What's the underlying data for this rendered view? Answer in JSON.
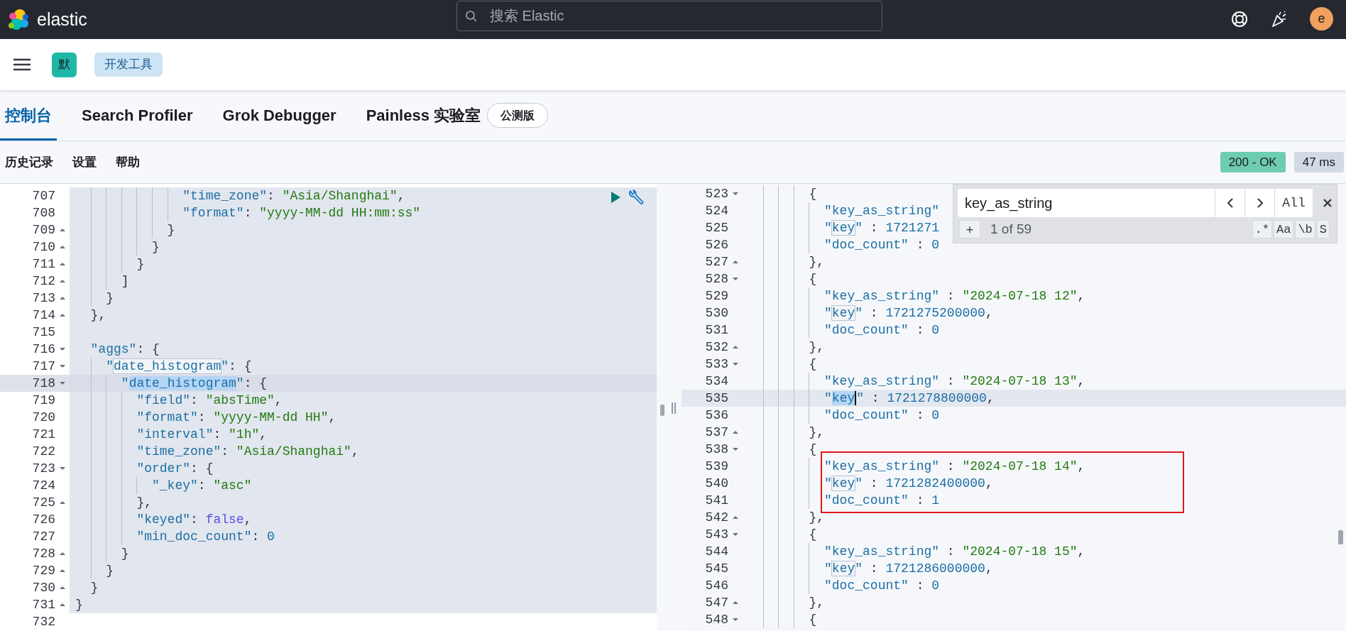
{
  "header": {
    "logo_text": "elastic",
    "search": {
      "placeholder": "搜索 Elastic"
    },
    "avatar": "e"
  },
  "nav": {
    "space_badge": "默",
    "breadcrumbs": [
      {
        "label": "开发工具"
      }
    ]
  },
  "tabs": [
    {
      "label": "控制台",
      "selected": true
    },
    {
      "label": "Search Profiler",
      "selected": false
    },
    {
      "label": "Grok Debugger",
      "selected": false
    },
    {
      "label": "Painless 实验室",
      "selected": false,
      "badge": "公测版"
    }
  ],
  "toolbar": {
    "links": [
      "历史记录",
      "设置",
      "帮助"
    ],
    "status": "200 - OK",
    "time": "47 ms"
  },
  "request_editor": {
    "lines": [
      {
        "number": "707",
        "highlighted": true,
        "selected": false,
        "fold_start": false,
        "fold_end": false,
        "tokens": [
          {
            "kind": "key",
            "text": "              \"time_zone\""
          },
          {
            "kind": "punct",
            "text": ": "
          },
          {
            "kind": "string",
            "text": "\"Asia/Shanghai\""
          },
          {
            "kind": "punct",
            "text": ","
          }
        ]
      },
      {
        "number": "708",
        "highlighted": true,
        "selected": false,
        "fold_start": false,
        "fold_end": false,
        "tokens": [
          {
            "kind": "key",
            "text": "              \"format\""
          },
          {
            "kind": "punct",
            "text": ": "
          },
          {
            "kind": "string",
            "text": "\"yyyy-MM-dd HH:mm:ss\""
          }
        ]
      },
      {
        "number": "709",
        "highlighted": true,
        "selected": false,
        "fold_start": false,
        "fold_end": true,
        "tokens": [
          {
            "kind": "punct",
            "text": "            }"
          }
        ]
      },
      {
        "number": "710",
        "highlighted": true,
        "selected": false,
        "fold_start": false,
        "fold_end": true,
        "tokens": [
          {
            "kind": "punct",
            "text": "          }"
          }
        ]
      },
      {
        "number": "711",
        "highlighted": true,
        "selected": false,
        "fold_start": false,
        "fold_end": true,
        "tokens": [
          {
            "kind": "punct",
            "text": "        }"
          }
        ]
      },
      {
        "number": "712",
        "highlighted": true,
        "selected": false,
        "fold_start": false,
        "fold_end": true,
        "tokens": [
          {
            "kind": "punct",
            "text": "      ]"
          }
        ]
      },
      {
        "number": "713",
        "highlighted": true,
        "selected": false,
        "fold_start": false,
        "fold_end": true,
        "tokens": [
          {
            "kind": "punct",
            "text": "    }"
          }
        ]
      },
      {
        "number": "714",
        "highlighted": true,
        "selected": false,
        "fold_start": false,
        "fold_end": true,
        "tokens": [
          {
            "kind": "punct",
            "text": "  },"
          }
        ]
      },
      {
        "number": "715",
        "highlighted": true,
        "selected": false,
        "fold_start": false,
        "fold_end": false
      },
      {
        "number": "716",
        "highlighted": true,
        "selected": false,
        "fold_start": true,
        "fold_end": false,
        "tokens": [
          {
            "kind": "key",
            "text": "  \"aggs\""
          },
          {
            "kind": "punct",
            "text": ": {"
          }
        ]
      },
      {
        "number": "717",
        "highlighted": true,
        "selected": false,
        "fold_start": true,
        "fold_end": false,
        "tokens": [
          {
            "kind": "key",
            "text": "    \""
          },
          {
            "kind": "match",
            "text": "date_histogram"
          },
          {
            "kind": "key",
            "text": "\""
          },
          {
            "kind": "punct",
            "text": ": {"
          }
        ]
      },
      {
        "number": "718",
        "highlighted": true,
        "selected": true,
        "fold_start": true,
        "fold_end": false,
        "tokens": [
          {
            "kind": "key",
            "text": "      \""
          },
          {
            "kind": "selection",
            "text": "date_histogram"
          },
          {
            "kind": "key",
            "text": "\""
          },
          {
            "kind": "punct",
            "text": ": {"
          }
        ]
      },
      {
        "number": "719",
        "highlighted": true,
        "selected": false,
        "fold_start": false,
        "fold_end": false,
        "tokens": [
          {
            "kind": "key",
            "text": "        \"field\""
          },
          {
            "kind": "punct",
            "text": ": "
          },
          {
            "kind": "string",
            "text": "\"absTime\""
          },
          {
            "kind": "punct",
            "text": ","
          }
        ]
      },
      {
        "number": "720",
        "highlighted": true,
        "selected": false,
        "fold_start": false,
        "fold_end": false,
        "tokens": [
          {
            "kind": "key",
            "text": "        \"format\""
          },
          {
            "kind": "punct",
            "text": ": "
          },
          {
            "kind": "string",
            "text": "\"yyyy-MM-dd HH\""
          },
          {
            "kind": "punct",
            "text": ","
          }
        ]
      },
      {
        "number": "721",
        "highlighted": true,
        "selected": false,
        "fold_start": false,
        "fold_end": false,
        "tokens": [
          {
            "kind": "key",
            "text": "        \"interval\""
          },
          {
            "kind": "punct",
            "text": ": "
          },
          {
            "kind": "string",
            "text": "\"1h\""
          },
          {
            "kind": "punct",
            "text": ","
          }
        ]
      },
      {
        "number": "722",
        "highlighted": true,
        "selected": false,
        "fold_start": false,
        "fold_end": false,
        "tokens": [
          {
            "kind": "key",
            "text": "        \"time_zone\""
          },
          {
            "kind": "punct",
            "text": ": "
          },
          {
            "kind": "string",
            "text": "\"Asia/Shanghai\""
          },
          {
            "kind": "punct",
            "text": ","
          }
        ]
      },
      {
        "number": "723",
        "highlighted": true,
        "selected": false,
        "fold_start": true,
        "fold_end": false,
        "tokens": [
          {
            "kind": "key",
            "text": "        \"order\""
          },
          {
            "kind": "punct",
            "text": ": {"
          }
        ]
      },
      {
        "number": "724",
        "highlighted": true,
        "selected": false,
        "fold_start": false,
        "fold_end": false,
        "tokens": [
          {
            "kind": "key",
            "text": "          \"_key\""
          },
          {
            "kind": "punct",
            "text": ": "
          },
          {
            "kind": "string",
            "text": "\"asc\""
          }
        ]
      },
      {
        "number": "725",
        "highlighted": true,
        "selected": false,
        "fold_start": false,
        "fold_end": true,
        "tokens": [
          {
            "kind": "punct",
            "text": "        },"
          }
        ]
      },
      {
        "number": "726",
        "highlighted": true,
        "selected": false,
        "fold_start": false,
        "fold_end": false,
        "tokens": [
          {
            "kind": "key",
            "text": "        \"keyed\""
          },
          {
            "kind": "punct",
            "text": ": "
          },
          {
            "kind": "boolean",
            "text": "false"
          },
          {
            "kind": "punct",
            "text": ","
          }
        ]
      },
      {
        "number": "727",
        "highlighted": true,
        "selected": false,
        "fold_start": false,
        "fold_end": false,
        "tokens": [
          {
            "kind": "key",
            "text": "        \"min_doc_count\""
          },
          {
            "kind": "punct",
            "text": ": "
          },
          {
            "kind": "number",
            "text": "0"
          }
        ]
      },
      {
        "number": "728",
        "highlighted": true,
        "selected": false,
        "fold_start": false,
        "fold_end": true,
        "tokens": [
          {
            "kind": "punct",
            "text": "      }"
          }
        ]
      },
      {
        "number": "729",
        "highlighted": true,
        "selected": false,
        "fold_start": false,
        "fold_end": true,
        "tokens": [
          {
            "kind": "punct",
            "text": "    }"
          }
        ]
      },
      {
        "number": "730",
        "highlighted": true,
        "selected": false,
        "fold_start": false,
        "fold_end": true,
        "tokens": [
          {
            "kind": "punct",
            "text": "  }"
          }
        ]
      },
      {
        "number": "731",
        "highlighted": true,
        "selected": false,
        "fold_start": false,
        "fold_end": true,
        "tokens": [
          {
            "kind": "punct",
            "text": "}"
          }
        ]
      },
      {
        "number": "732",
        "highlighted": false,
        "selected": false,
        "fold_start": false,
        "fold_end": false
      }
    ]
  },
  "response_editor": {
    "find": {
      "value": "key_as_string",
      "all_button": "All",
      "add_button": "+",
      "count": "1 of 59",
      "options": [
        ".*",
        "Aa",
        "\\b",
        "S"
      ]
    },
    "lines": [
      {
        "number": "523",
        "selected": false,
        "boxed": false,
        "fold_start": true,
        "fold_end": false,
        "tokens": [
          {
            "kind": "punct",
            "text": "        {"
          }
        ]
      },
      {
        "number": "524",
        "selected": false,
        "boxed": false,
        "fold_start": false,
        "fold_end": false,
        "tokens": [
          {
            "kind": "key",
            "text": "          \"key_as_string\""
          }
        ]
      },
      {
        "number": "525",
        "selected": false,
        "boxed": false,
        "fold_start": false,
        "fold_end": false,
        "tokens": [
          {
            "kind": "key",
            "text": "          \""
          },
          {
            "kind": "match",
            "text": "key"
          },
          {
            "kind": "key",
            "text": "\""
          },
          {
            "kind": "punct",
            "text": " : "
          },
          {
            "kind": "number",
            "text": "1721271"
          }
        ]
      },
      {
        "number": "526",
        "selected": false,
        "boxed": false,
        "fold_start": false,
        "fold_end": false,
        "tokens": [
          {
            "kind": "key",
            "text": "          \"doc_count\""
          },
          {
            "kind": "punct",
            "text": " : "
          },
          {
            "kind": "number",
            "text": "0"
          }
        ]
      },
      {
        "number": "527",
        "selected": false,
        "boxed": false,
        "fold_start": false,
        "fold_end": true,
        "tokens": [
          {
            "kind": "punct",
            "text": "        },"
          }
        ]
      },
      {
        "number": "528",
        "selected": false,
        "boxed": false,
        "fold_start": true,
        "fold_end": false,
        "tokens": [
          {
            "kind": "punct",
            "text": "        {"
          }
        ]
      },
      {
        "number": "529",
        "selected": false,
        "boxed": false,
        "fold_start": false,
        "fold_end": false,
        "tokens": [
          {
            "kind": "key",
            "text": "          \"key_as_string\""
          },
          {
            "kind": "punct",
            "text": " : "
          },
          {
            "kind": "string",
            "text": "\"2024-07-18 12\""
          },
          {
            "kind": "punct",
            "text": ","
          }
        ]
      },
      {
        "number": "530",
        "selected": false,
        "boxed": false,
        "fold_start": false,
        "fold_end": false,
        "tokens": [
          {
            "kind": "key",
            "text": "          \""
          },
          {
            "kind": "match",
            "text": "key"
          },
          {
            "kind": "key",
            "text": "\""
          },
          {
            "kind": "punct",
            "text": " : "
          },
          {
            "kind": "number",
            "text": "1721275200000"
          },
          {
            "kind": "punct",
            "text": ","
          }
        ]
      },
      {
        "number": "531",
        "selected": false,
        "boxed": false,
        "fold_start": false,
        "fold_end": false,
        "tokens": [
          {
            "kind": "key",
            "text": "          \"doc_count\""
          },
          {
            "kind": "punct",
            "text": " : "
          },
          {
            "kind": "number",
            "text": "0"
          }
        ]
      },
      {
        "number": "532",
        "selected": false,
        "boxed": false,
        "fold_start": false,
        "fold_end": true,
        "tokens": [
          {
            "kind": "punct",
            "text": "        },"
          }
        ]
      },
      {
        "number": "533",
        "selected": false,
        "boxed": false,
        "fold_start": true,
        "fold_end": false,
        "tokens": [
          {
            "kind": "punct",
            "text": "        {"
          }
        ]
      },
      {
        "number": "534",
        "selected": false,
        "boxed": false,
        "fold_start": false,
        "fold_end": false,
        "tokens": [
          {
            "kind": "key",
            "text": "          \"key_as_string\""
          },
          {
            "kind": "punct",
            "text": " : "
          },
          {
            "kind": "string",
            "text": "\"2024-07-18 13\""
          },
          {
            "kind": "punct",
            "text": ","
          }
        ]
      },
      {
        "number": "535",
        "selected": true,
        "boxed": false,
        "fold_start": false,
        "fold_end": false,
        "tokens": [
          {
            "kind": "key",
            "text": "          \""
          },
          {
            "kind": "selection_cursor",
            "text": "key"
          },
          {
            "kind": "key",
            "text": "\""
          },
          {
            "kind": "punct",
            "text": " : "
          },
          {
            "kind": "number",
            "text": "1721278800000"
          },
          {
            "kind": "punct",
            "text": ","
          }
        ]
      },
      {
        "number": "536",
        "selected": false,
        "boxed": false,
        "fold_start": false,
        "fold_end": false,
        "tokens": [
          {
            "kind": "key",
            "text": "          \"doc_count\""
          },
          {
            "kind": "punct",
            "text": " : "
          },
          {
            "kind": "number",
            "text": "0"
          }
        ]
      },
      {
        "number": "537",
        "selected": false,
        "boxed": false,
        "fold_start": false,
        "fold_end": true,
        "tokens": [
          {
            "kind": "punct",
            "text": "        },"
          }
        ]
      },
      {
        "number": "538",
        "selected": false,
        "boxed": false,
        "fold_start": true,
        "fold_end": false,
        "tokens": [
          {
            "kind": "punct",
            "text": "        {"
          }
        ]
      },
      {
        "number": "539",
        "selected": false,
        "boxed": true,
        "fold_start": false,
        "fold_end": false,
        "tokens": [
          {
            "kind": "key",
            "text": "          \"key_as_string\""
          },
          {
            "kind": "punct",
            "text": " : "
          },
          {
            "kind": "string",
            "text": "\"2024-07-18 14\""
          },
          {
            "kind": "punct",
            "text": ","
          }
        ]
      },
      {
        "number": "540",
        "selected": false,
        "boxed": true,
        "fold_start": false,
        "fold_end": false,
        "tokens": [
          {
            "kind": "key",
            "text": "          \""
          },
          {
            "kind": "match",
            "text": "key"
          },
          {
            "kind": "key",
            "text": "\""
          },
          {
            "kind": "punct",
            "text": " : "
          },
          {
            "kind": "number",
            "text": "1721282400000"
          },
          {
            "kind": "punct",
            "text": ","
          }
        ]
      },
      {
        "number": "541",
        "selected": false,
        "boxed": true,
        "fold_start": false,
        "fold_end": false,
        "tokens": [
          {
            "kind": "key",
            "text": "          \"doc_count\""
          },
          {
            "kind": "punct",
            "text": " : "
          },
          {
            "kind": "number",
            "text": "1"
          }
        ]
      },
      {
        "number": "542",
        "selected": false,
        "boxed": false,
        "fold_start": false,
        "fold_end": true,
        "tokens": [
          {
            "kind": "punct",
            "text": "        },"
          }
        ]
      },
      {
        "number": "543",
        "selected": false,
        "boxed": false,
        "fold_start": true,
        "fold_end": false,
        "tokens": [
          {
            "kind": "punct",
            "text": "        {"
          }
        ]
      },
      {
        "number": "544",
        "selected": false,
        "boxed": false,
        "fold_start": false,
        "fold_end": false,
        "tokens": [
          {
            "kind": "key",
            "text": "          \"key_as_string\""
          },
          {
            "kind": "punct",
            "text": " : "
          },
          {
            "kind": "string",
            "text": "\"2024-07-18 15\""
          },
          {
            "kind": "punct",
            "text": ","
          }
        ]
      },
      {
        "number": "545",
        "selected": false,
        "boxed": false,
        "fold_start": false,
        "fold_end": false,
        "tokens": [
          {
            "kind": "key",
            "text": "          \""
          },
          {
            "kind": "match",
            "text": "key"
          },
          {
            "kind": "key",
            "text": "\""
          },
          {
            "kind": "punct",
            "text": " : "
          },
          {
            "kind": "number",
            "text": "1721286000000"
          },
          {
            "kind": "punct",
            "text": ","
          }
        ]
      },
      {
        "number": "546",
        "selected": false,
        "boxed": false,
        "fold_start": false,
        "fold_end": false,
        "tokens": [
          {
            "kind": "key",
            "text": "          \"doc_count\""
          },
          {
            "kind": "punct",
            "text": " : "
          },
          {
            "kind": "number",
            "text": "0"
          }
        ]
      },
      {
        "number": "547",
        "selected": false,
        "boxed": false,
        "fold_start": false,
        "fold_end": true,
        "tokens": [
          {
            "kind": "punct",
            "text": "        },"
          }
        ]
      },
      {
        "number": "548",
        "selected": false,
        "boxed": false,
        "fold_start": true,
        "fold_end": false,
        "tokens": [
          {
            "kind": "punct",
            "text": "        {"
          }
        ]
      }
    ]
  }
}
